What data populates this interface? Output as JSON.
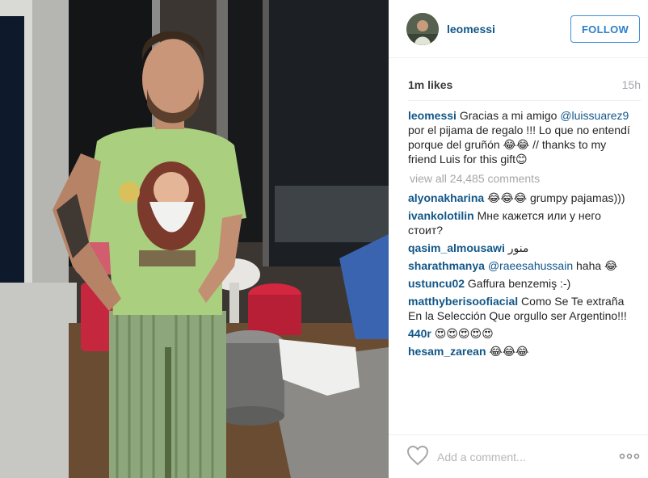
{
  "post": {
    "username": "leomessi",
    "follow_label": "FOLLOW",
    "likes": "1m likes",
    "time": "15h"
  },
  "caption": {
    "username": "leomessi",
    "text_before": "Gracias a mi amigo ",
    "mention": "@luissuarez9",
    "text_after": " por el pijama de regalo !!! Lo que no entendí porque del gruñón 😂😂 // thanks to my friend Luis for this gift😊"
  },
  "view_all": "view all 24,485 comments",
  "comments": [
    {
      "user": "alyonakharina",
      "text": "😂😂😂 grumpy pajamas)))"
    },
    {
      "user": "ivankolotilin",
      "text": "Мне кажется или у него стоит?"
    },
    {
      "user": "qasim_almousawi",
      "text": "منور"
    },
    {
      "user": "sharathmanya",
      "mention": "@raeesahussain",
      "text": " haha 😂"
    },
    {
      "user": "ustuncu02",
      "text": "Gaffura benzemiş :-)"
    },
    {
      "user": "matthyberisoofiacial",
      "text": "Como Se Te extraña En la Selección Que orgullo ser Argentino!!!"
    },
    {
      "user": "440r",
      "text": "😍😍😍😍😍"
    },
    {
      "user": "hesam_zarean",
      "text": "😂😂😂"
    }
  ],
  "add_comment_placeholder": "Add a comment...",
  "icons": {
    "like": "heart-outline-icon",
    "more": "more-options-icon"
  },
  "colors": {
    "link": "#125688",
    "follow": "#2d80c9",
    "muted": "#a5a7aa"
  }
}
